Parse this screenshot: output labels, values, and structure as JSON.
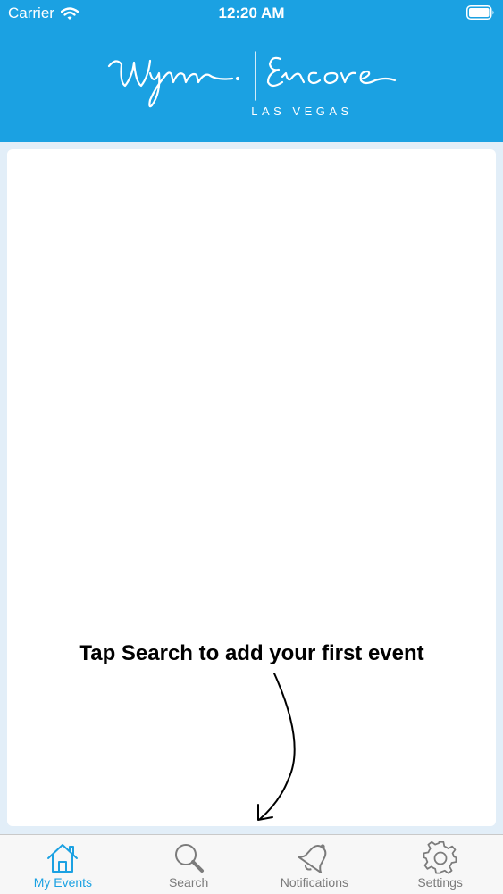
{
  "status_bar": {
    "carrier": "Carrier",
    "time": "12:20 AM",
    "wifi_icon": "wifi-icon",
    "battery_icon": "battery-icon"
  },
  "header": {
    "logo_icon": "wynn-encore-logo",
    "logo_left": "Wynn",
    "logo_right": "Encore",
    "logo_subtitle": "LAS VEGAS",
    "background_color": "#1ba1e2"
  },
  "content": {
    "empty_hint": "Tap Search to add your first event",
    "arrow_icon": "curved-arrow-down-icon"
  },
  "tab_bar": {
    "active_color": "#1ba1e2",
    "inactive_color": "#7b7b7b",
    "tabs": [
      {
        "label": "My Events",
        "icon": "home-icon",
        "active": true
      },
      {
        "label": "Search",
        "icon": "search-icon",
        "active": false
      },
      {
        "label": "Notifications",
        "icon": "bell-icon",
        "active": false
      },
      {
        "label": "Settings",
        "icon": "gear-icon",
        "active": false
      }
    ]
  }
}
